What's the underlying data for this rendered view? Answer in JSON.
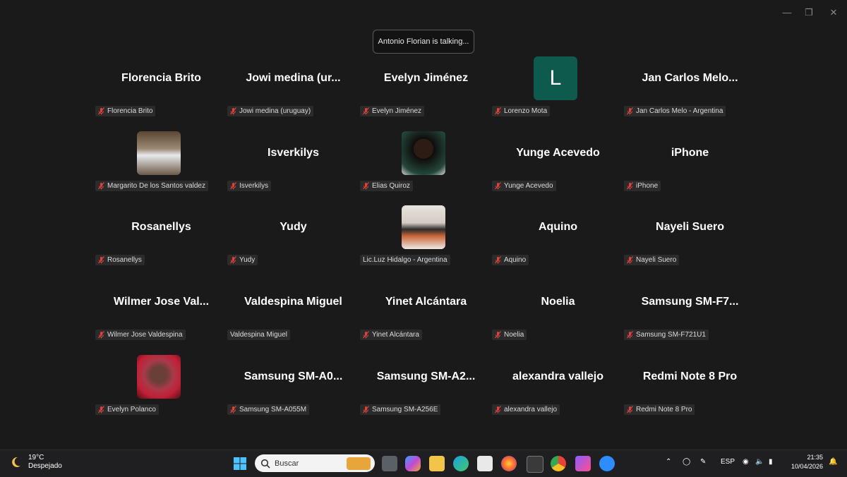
{
  "meeting": {
    "talking_indicator": "Antonio Florian is talking...",
    "participants": [
      {
        "name": "Florencia Brito",
        "label": "Florencia Brito"
      },
      {
        "name": "Jowi medina (ur...",
        "label": "Jowi medina (uruguay)"
      },
      {
        "name": "Evelyn Jiménez",
        "label": "Evelyn Jiménez"
      },
      {
        "name": "",
        "avatar_letter": "L",
        "label": "Lorenzo Mota"
      },
      {
        "name": "Jan Carlos Melo...",
        "label": "Jan Carlos Melo - Argentina"
      },
      {
        "name": "",
        "label": "Margarito De los Santos valdez"
      },
      {
        "name": "Isverkilys",
        "label": "Isverkilys"
      },
      {
        "name": "",
        "label": "Elias Quiroz"
      },
      {
        "name": "Yunge Acevedo",
        "label": "Yunge Acevedo"
      },
      {
        "name": "iPhone",
        "label": "iPhone"
      },
      {
        "name": "Rosanellys",
        "label": "Rosanellys"
      },
      {
        "name": "Yudy",
        "label": "Yudy"
      },
      {
        "name": "",
        "label": "Lic.Luz Hidalgo - Argentina"
      },
      {
        "name": "Aquino",
        "label": "Aquino"
      },
      {
        "name": "Nayeli Suero",
        "label": "Nayeli Suero"
      },
      {
        "name": "Wilmer Jose Val...",
        "label": "Wilmer Jose Valdespina"
      },
      {
        "name": "Valdespina Miguel",
        "label": "Valdespina Miguel"
      },
      {
        "name": "Yinet Alcántara",
        "label": "Yinet Alcántara"
      },
      {
        "name": "Noelia",
        "label": "Noelia"
      },
      {
        "name": "Samsung SM-F7...",
        "label": "Samsung SM-F721U1"
      },
      {
        "name": "",
        "label": "Evelyn Polanco"
      },
      {
        "name": "Samsung SM-A0...",
        "label": "Samsung SM-A055M"
      },
      {
        "name": "Samsung SM-A2...",
        "label": "Samsung SM-A256E"
      },
      {
        "name": "alexandra vallejo",
        "label": "alexandra vallejo"
      },
      {
        "name": "Redmi Note 8 Pro",
        "label": "Redmi Note 8 Pro"
      }
    ]
  },
  "taskbar": {
    "weather_temp": "19°C",
    "weather_desc": "Despejado",
    "search_placeholder": "Buscar",
    "language": "ESP",
    "time": "21:35",
    "date": "10/04/2026"
  },
  "colors": {
    "background": "#1a1a1a",
    "muted_mic": "#e0413a",
    "letter_avatar": "#0e5a4c"
  }
}
